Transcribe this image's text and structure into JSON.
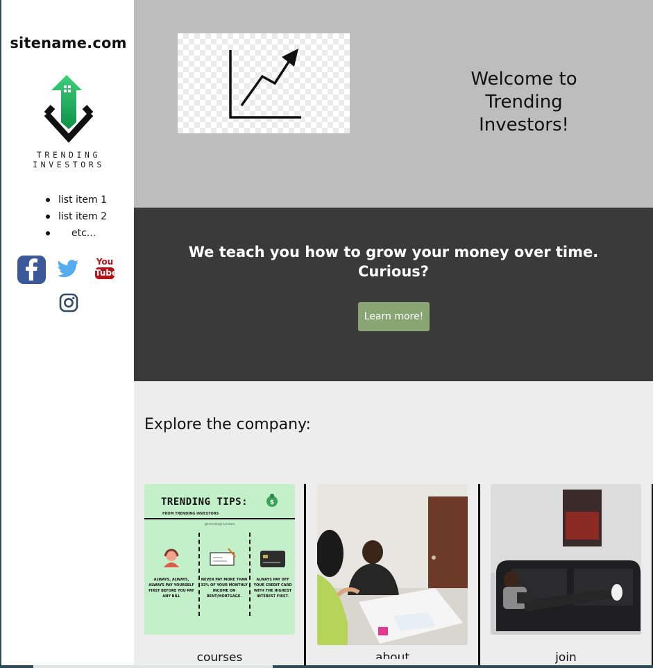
{
  "sidebar": {
    "site_name": "sitename.com",
    "logo_text": "TRENDING INVESTORS",
    "list_items": [
      "list item 1",
      "list item 2",
      "etc..."
    ],
    "socials": [
      {
        "name": "facebook-icon",
        "color": "#3b5998"
      },
      {
        "name": "twitter-icon",
        "color": "#55acee"
      },
      {
        "name": "youtube-icon",
        "color": "#b31217",
        "text_top": "You",
        "text_bottom": "Tube"
      },
      {
        "name": "instagram-icon",
        "color": "#2e4a66"
      }
    ]
  },
  "hero": {
    "title": "Welcome to Trending Investors!",
    "image_icon": "growth-chart-icon"
  },
  "pitch": {
    "text": "We teach you how to grow your money over time. Curious?",
    "button_label": "Learn more!",
    "button_color": "#8aa574"
  },
  "explore": {
    "title": "Explore the company:",
    "cards": [
      {
        "label": "courses",
        "image": {
          "heading": "TRENDING TIPS:",
          "subheading": "FROM TRENDING INVESTORS",
          "handle": "@trendinginvestors",
          "tips": [
            "ALWAYS, ALWAYS, ALWAYS PAY YOURSELF FIRST BEFORE YOU PAY ANY BILL",
            "NEVER PAY MORE THAN 33% OF YOUR MONTHLY INCOME ON RENT/MORTGAGE.",
            "ALWAYS PAY OFF YOUR CREDIT CARD WITH THE HIGHEST INTEREST FIRST."
          ]
        }
      },
      {
        "label": "about",
        "image": "office-meeting-photo"
      },
      {
        "label": "join",
        "image": "man-on-couch-photo"
      }
    ]
  },
  "colors": {
    "hero_bg": "#bdbdbd",
    "pitch_bg": "#3a3a3a",
    "explore_bg": "#ededed",
    "tips_bg": "#c3efc9",
    "logo_green": "#1fae5e"
  }
}
